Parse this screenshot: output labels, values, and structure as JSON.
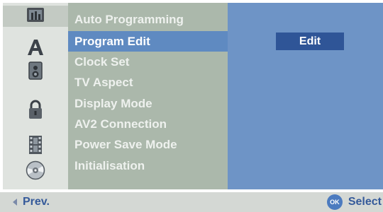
{
  "menu": {
    "items": [
      {
        "label": "Auto Programming",
        "selected": false
      },
      {
        "label": "Program Edit",
        "selected": true
      },
      {
        "label": "Clock Set",
        "selected": false
      },
      {
        "label": "TV Aspect",
        "selected": false
      },
      {
        "label": "Display Mode",
        "selected": false
      },
      {
        "label": "AV2 Connection",
        "selected": false
      },
      {
        "label": "Power Save Mode",
        "selected": false
      },
      {
        "label": "Initialisation",
        "selected": false
      }
    ]
  },
  "value_panel": {
    "value": "Edit"
  },
  "icons": [
    "general-settings-icon",
    "language-icon",
    "audio-icon",
    "lock-icon",
    "recording-film-icon",
    "disc-icon"
  ],
  "footer": {
    "prev_label": "Prev.",
    "ok_label": "OK",
    "select_label": "Select"
  },
  "colors": {
    "selected_item": "#5f8ac1",
    "menu_panel": "#abb8ab",
    "value_panel": "#6e94c6",
    "value_box": "#2f5597",
    "icon_rail": "#dfe3df"
  }
}
